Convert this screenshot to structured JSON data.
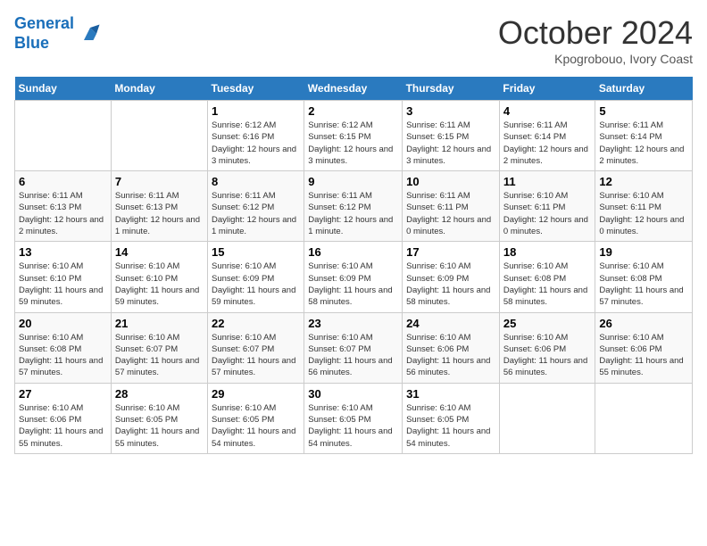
{
  "header": {
    "logo_line1": "General",
    "logo_line2": "Blue",
    "month": "October 2024",
    "location": "Kpogrobouo, Ivory Coast"
  },
  "days_of_week": [
    "Sunday",
    "Monday",
    "Tuesday",
    "Wednesday",
    "Thursday",
    "Friday",
    "Saturday"
  ],
  "weeks": [
    [
      {
        "day": "",
        "info": ""
      },
      {
        "day": "",
        "info": ""
      },
      {
        "day": "1",
        "info": "Sunrise: 6:12 AM\nSunset: 6:16 PM\nDaylight: 12 hours and 3 minutes."
      },
      {
        "day": "2",
        "info": "Sunrise: 6:12 AM\nSunset: 6:15 PM\nDaylight: 12 hours and 3 minutes."
      },
      {
        "day": "3",
        "info": "Sunrise: 6:11 AM\nSunset: 6:15 PM\nDaylight: 12 hours and 3 minutes."
      },
      {
        "day": "4",
        "info": "Sunrise: 6:11 AM\nSunset: 6:14 PM\nDaylight: 12 hours and 2 minutes."
      },
      {
        "day": "5",
        "info": "Sunrise: 6:11 AM\nSunset: 6:14 PM\nDaylight: 12 hours and 2 minutes."
      }
    ],
    [
      {
        "day": "6",
        "info": "Sunrise: 6:11 AM\nSunset: 6:13 PM\nDaylight: 12 hours and 2 minutes."
      },
      {
        "day": "7",
        "info": "Sunrise: 6:11 AM\nSunset: 6:13 PM\nDaylight: 12 hours and 1 minute."
      },
      {
        "day": "8",
        "info": "Sunrise: 6:11 AM\nSunset: 6:12 PM\nDaylight: 12 hours and 1 minute."
      },
      {
        "day": "9",
        "info": "Sunrise: 6:11 AM\nSunset: 6:12 PM\nDaylight: 12 hours and 1 minute."
      },
      {
        "day": "10",
        "info": "Sunrise: 6:11 AM\nSunset: 6:11 PM\nDaylight: 12 hours and 0 minutes."
      },
      {
        "day": "11",
        "info": "Sunrise: 6:10 AM\nSunset: 6:11 PM\nDaylight: 12 hours and 0 minutes."
      },
      {
        "day": "12",
        "info": "Sunrise: 6:10 AM\nSunset: 6:11 PM\nDaylight: 12 hours and 0 minutes."
      }
    ],
    [
      {
        "day": "13",
        "info": "Sunrise: 6:10 AM\nSunset: 6:10 PM\nDaylight: 11 hours and 59 minutes."
      },
      {
        "day": "14",
        "info": "Sunrise: 6:10 AM\nSunset: 6:10 PM\nDaylight: 11 hours and 59 minutes."
      },
      {
        "day": "15",
        "info": "Sunrise: 6:10 AM\nSunset: 6:09 PM\nDaylight: 11 hours and 59 minutes."
      },
      {
        "day": "16",
        "info": "Sunrise: 6:10 AM\nSunset: 6:09 PM\nDaylight: 11 hours and 58 minutes."
      },
      {
        "day": "17",
        "info": "Sunrise: 6:10 AM\nSunset: 6:09 PM\nDaylight: 11 hours and 58 minutes."
      },
      {
        "day": "18",
        "info": "Sunrise: 6:10 AM\nSunset: 6:08 PM\nDaylight: 11 hours and 58 minutes."
      },
      {
        "day": "19",
        "info": "Sunrise: 6:10 AM\nSunset: 6:08 PM\nDaylight: 11 hours and 57 minutes."
      }
    ],
    [
      {
        "day": "20",
        "info": "Sunrise: 6:10 AM\nSunset: 6:08 PM\nDaylight: 11 hours and 57 minutes."
      },
      {
        "day": "21",
        "info": "Sunrise: 6:10 AM\nSunset: 6:07 PM\nDaylight: 11 hours and 57 minutes."
      },
      {
        "day": "22",
        "info": "Sunrise: 6:10 AM\nSunset: 6:07 PM\nDaylight: 11 hours and 57 minutes."
      },
      {
        "day": "23",
        "info": "Sunrise: 6:10 AM\nSunset: 6:07 PM\nDaylight: 11 hours and 56 minutes."
      },
      {
        "day": "24",
        "info": "Sunrise: 6:10 AM\nSunset: 6:06 PM\nDaylight: 11 hours and 56 minutes."
      },
      {
        "day": "25",
        "info": "Sunrise: 6:10 AM\nSunset: 6:06 PM\nDaylight: 11 hours and 56 minutes."
      },
      {
        "day": "26",
        "info": "Sunrise: 6:10 AM\nSunset: 6:06 PM\nDaylight: 11 hours and 55 minutes."
      }
    ],
    [
      {
        "day": "27",
        "info": "Sunrise: 6:10 AM\nSunset: 6:06 PM\nDaylight: 11 hours and 55 minutes."
      },
      {
        "day": "28",
        "info": "Sunrise: 6:10 AM\nSunset: 6:05 PM\nDaylight: 11 hours and 55 minutes."
      },
      {
        "day": "29",
        "info": "Sunrise: 6:10 AM\nSunset: 6:05 PM\nDaylight: 11 hours and 54 minutes."
      },
      {
        "day": "30",
        "info": "Sunrise: 6:10 AM\nSunset: 6:05 PM\nDaylight: 11 hours and 54 minutes."
      },
      {
        "day": "31",
        "info": "Sunrise: 6:10 AM\nSunset: 6:05 PM\nDaylight: 11 hours and 54 minutes."
      },
      {
        "day": "",
        "info": ""
      },
      {
        "day": "",
        "info": ""
      }
    ]
  ]
}
